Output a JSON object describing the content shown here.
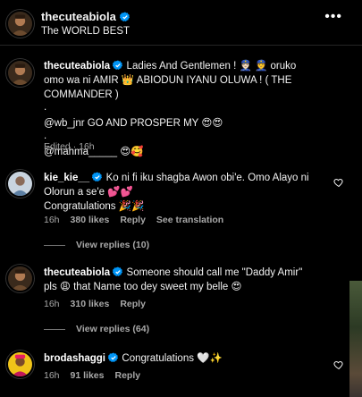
{
  "header": {
    "username": "thecuteabiola",
    "subtitle": "The WORLD BEST",
    "more_icon": "more-horizontal-icon"
  },
  "caption": {
    "username": "thecuteabiola",
    "line1": "Ladies And Gentlemen ! 👮🏻 👮 oruko omo wa ni AMIR 👑 ABIODUN IYANU OLUWA ! ( THE COMMANDER )",
    "dot1": ".",
    "line2": "@wb_jnr GO AND PROSPER MY 😍😍",
    "dot2": ".",
    "line3": "@mahma_____ 😍🥰",
    "meta": "Edited · 16h"
  },
  "comments": [
    {
      "username": "kie_kie__",
      "text": "Ko ni fi iku shagba Awon obi'e. Omo Alayo ni Olorun a se'e 💕💕",
      "text2": "Congratulations 🎉🎉",
      "time": "16h",
      "likes": "380 likes",
      "reply": "Reply",
      "translate": "See translation",
      "view_replies": "View replies (10)"
    },
    {
      "username": "thecuteabiola",
      "text": "Someone should call me \"Daddy Amir\" pls 😩 that Name too dey sweet my belle 😍",
      "time": "16h",
      "likes": "310 likes",
      "reply": "Reply",
      "view_replies": "View replies (64)"
    },
    {
      "username": "brodashaggi",
      "text": "Congratulations 🤍✨",
      "time": "16h",
      "likes": "91 likes",
      "reply": "Reply"
    }
  ],
  "colors": {
    "background": "#000000",
    "verified": "#0095f6",
    "muted": "#a8a8a8"
  }
}
